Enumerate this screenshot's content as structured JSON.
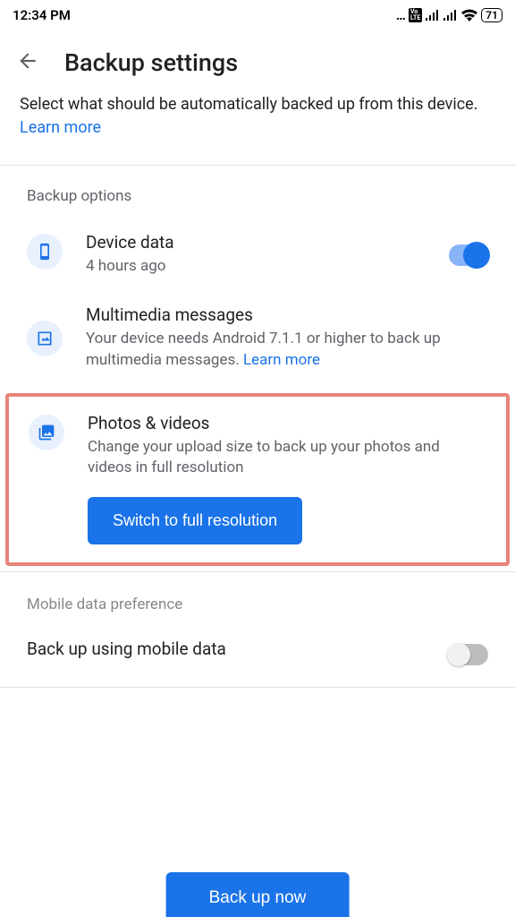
{
  "status": {
    "time": "12:34 PM",
    "battery": "71"
  },
  "header": {
    "title": "Backup settings"
  },
  "intro": {
    "text": "Select what should be automatically backed up from this device. ",
    "learn": "Learn more"
  },
  "sections": {
    "options_label": "Backup options",
    "device_data": {
      "title": "Device data",
      "sub": "4 hours ago"
    },
    "mms": {
      "title": "Multimedia messages",
      "sub": "Your device needs Android 7.1.1 or higher to back up multimedia messages. ",
      "learn": "Learn more"
    },
    "photos": {
      "title": "Photos & videos",
      "sub": "Change your upload size to back up your photos and videos in full resolution",
      "button": "Switch to full resolution"
    },
    "mobile_pref_label": "Mobile data preference",
    "mobile_data": {
      "title": "Back up using mobile data"
    }
  },
  "footer": {
    "button": "Back up now"
  }
}
